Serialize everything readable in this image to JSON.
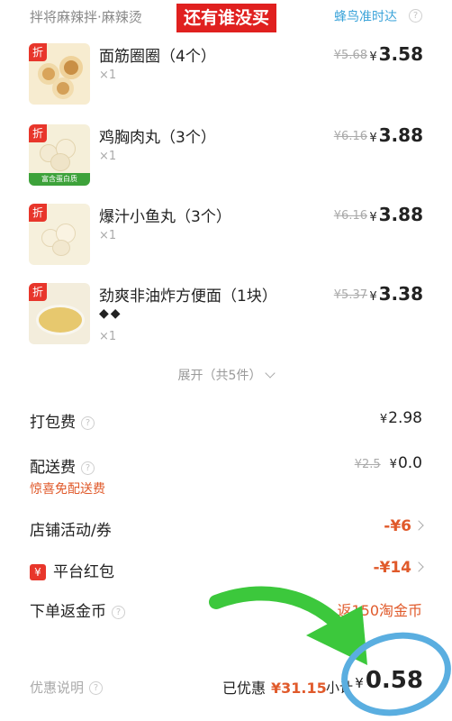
{
  "header": {
    "shop_name": "拌将麻辣拌·麻辣烫",
    "banner": "还有谁没买",
    "delivery": "蜂鸟准时达"
  },
  "items": [
    {
      "badge": "折",
      "name": "面筋圈圈（4个）",
      "qty": "×1",
      "old_price": "¥5.68",
      "currency": "¥",
      "price": "3.58"
    },
    {
      "badge": "折",
      "name": "鸡胸肉丸（3个）",
      "qty": "×1",
      "old_price": "¥6.16",
      "currency": "¥",
      "price": "3.88",
      "image_label": "富含蛋白质"
    },
    {
      "badge": "折",
      "name": "爆汁小鱼丸（3个）",
      "qty": "×1",
      "old_price": "¥6.16",
      "currency": "¥",
      "price": "3.88"
    },
    {
      "badge": "折",
      "name": "劲爽非油炸方便面（1块）",
      "extra": "◆◆",
      "qty": "×1",
      "old_price": "¥5.37",
      "currency": "¥",
      "price": "3.38"
    }
  ],
  "expand_label": "展开（共5件）",
  "fees": {
    "packing": {
      "label": "打包费",
      "currency": "¥",
      "value": "2.98"
    },
    "delivery": {
      "label": "配送费",
      "old": "¥2.5",
      "currency": "¥",
      "value": "0.0",
      "note": "惊喜免配送费"
    },
    "promo": {
      "label": "店铺活动/券",
      "value": "-¥6"
    },
    "redpacket": {
      "icon": "¥",
      "label": "平台红包",
      "value": "-¥14"
    },
    "coins": {
      "label": "下单返金币",
      "value": "返150淘金币"
    }
  },
  "summary": {
    "note_label": "优惠说明",
    "saved_label": "已优惠",
    "saved_amount": "¥31.15",
    "subtotal_label": "小计",
    "currency": "¥",
    "total": "0.58"
  },
  "colors": {
    "accent_red": "#e05a2b",
    "discount_badge": "#e8362b",
    "delivery_blue": "#3aa3d9",
    "arrow_green": "#3cc83c",
    "circle_blue": "#5aaee0"
  },
  "icons": [
    "question-icon",
    "chevron-down-icon",
    "chevron-right-icon",
    "red-packet-icon",
    "green-arrow-annotation",
    "blue-circle-annotation"
  ]
}
